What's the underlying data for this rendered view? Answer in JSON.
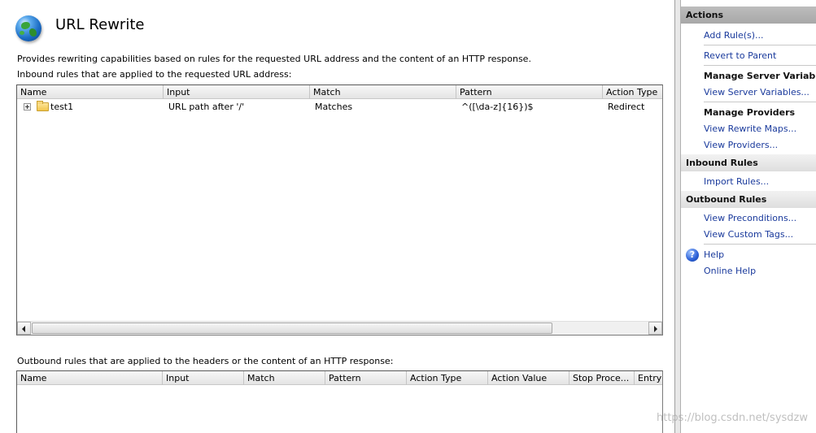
{
  "page": {
    "title": "URL Rewrite",
    "description": "Provides rewriting capabilities based on rules for the requested URL address and the content of an HTTP response.",
    "inbound_caption": "Inbound rules that are applied to the requested URL address:",
    "outbound_caption": "Outbound rules that are applied to the headers or the content of an HTTP response:"
  },
  "inbound": {
    "columns": [
      "Name",
      "Input",
      "Match",
      "Pattern",
      "Action Type"
    ],
    "rows": [
      {
        "name": "test1",
        "input": "URL path after '/'",
        "match": "Matches",
        "pattern": "^([\\da-z]{16})$",
        "action_type": "Redirect"
      }
    ]
  },
  "outbound": {
    "columns": [
      "Name",
      "Input",
      "Match",
      "Pattern",
      "Action Type",
      "Action Value",
      "Stop Proce...",
      "Entry"
    ]
  },
  "actions": {
    "title": "Actions",
    "add_rules": "Add Rule(s)...",
    "revert_to_parent": "Revert to Parent",
    "manage_server_variables": "Manage Server Variables",
    "view_server_variables": "View Server Variables...",
    "manage_providers": "Manage Providers",
    "view_rewrite_maps": "View Rewrite Maps...",
    "view_providers": "View Providers...",
    "inbound_rules": "Inbound Rules",
    "import_rules": "Import Rules...",
    "outbound_rules": "Outbound Rules",
    "view_preconditions": "View Preconditions...",
    "view_custom_tags": "View Custom Tags...",
    "help": "Help",
    "online_help": "Online Help"
  },
  "watermark": "https://blog.csdn.net/sysdzw"
}
